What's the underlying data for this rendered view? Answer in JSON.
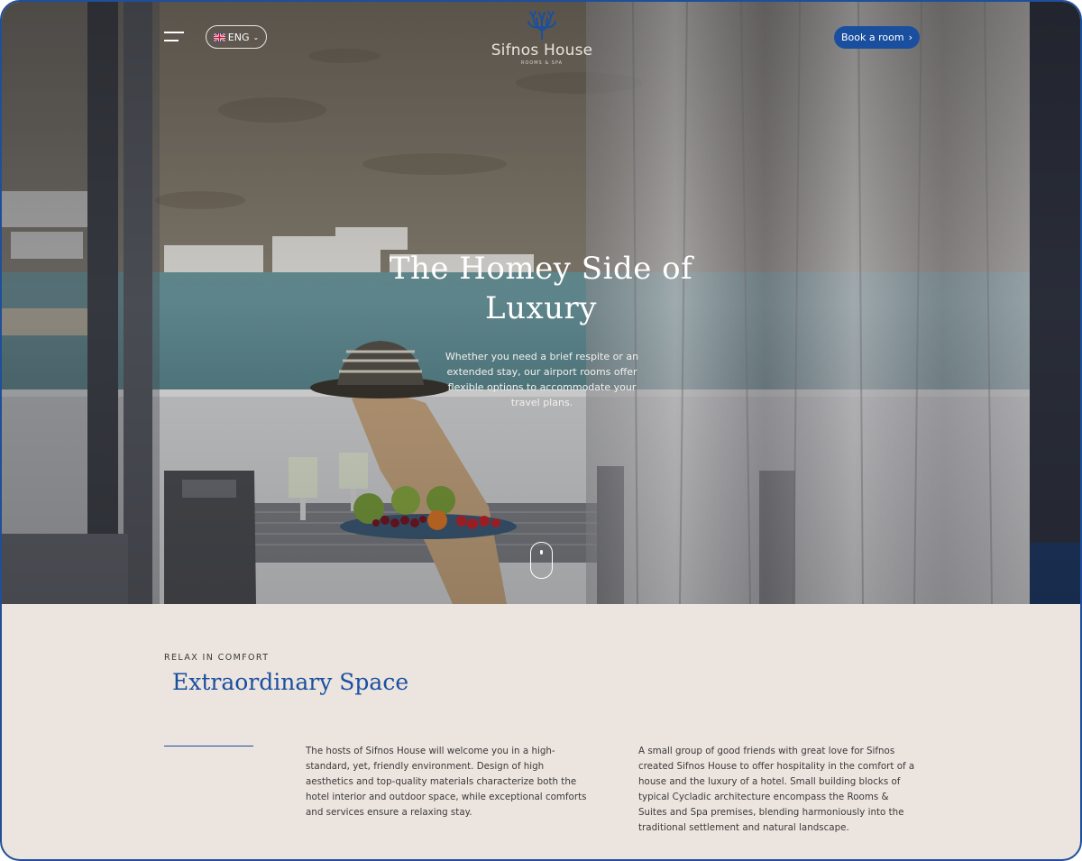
{
  "header": {
    "language": "ENG",
    "logo_name": "Sifnos House",
    "logo_sub": "ROOMS & SPA",
    "book_label": "Book a room"
  },
  "hero": {
    "title": "The Homey Side of Luxury",
    "text": "Whether you need a brief respite or an extended stay, our airport rooms offer flexible options to accommodate your travel plans."
  },
  "intro": {
    "eyebrow": "RELAX IN COMFORT",
    "title": "Extraordinary Space",
    "col1": "The hosts of Sifnos House will welcome you in a high-standard, yet, friendly environment. Design of high aesthetics and top-quality materials characterize both the hotel interior and outdoor space, while exceptional comforts and services ensure a relaxing stay.",
    "col2": "A small group of good friends with great love for Sifnos created Sifnos House to offer hospitality in the comfort of a house and the luxury of a hotel. Small building blocks of typical Cycladic architecture encompass the Rooms & Suites and Spa premises, blending harmoniously into the traditional settlement and natural landscape."
  },
  "colors": {
    "accent": "#1a4fa0",
    "section_bg": "#ece4df"
  },
  "icons": [
    "menu-icon",
    "uk-flag-icon",
    "chevron-down-icon",
    "chevron-right-icon",
    "scroll-mouse-icon"
  ]
}
